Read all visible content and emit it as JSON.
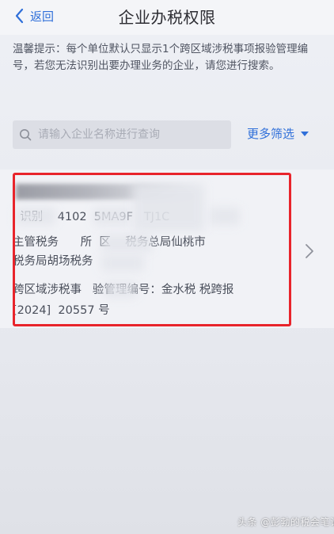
{
  "header": {
    "back_label": "返回",
    "title": "企业办税权限"
  },
  "notice": {
    "text": "温馨提示：每个单位默认只显示1个跨区域涉税事项报验管理编号，若您无法识别出要办理业务的企业，请您进行搜索。"
  },
  "search": {
    "placeholder": "请输入企业名称进行查询",
    "value": "",
    "more_filter_label": "更多筛选"
  },
  "card": {
    "title": "",
    "taxpayer_id_line": "  识别    4102  5MA9F   TJ1C",
    "authority_line_1": "主管税务      所  区    税务总局仙桃市",
    "authority_line_2": "税务局胡场税务",
    "report_line_1": "跨区域涉税事   验管理编号：金水税 税跨报",
    "report_line_2": "[2024]  20557 号"
  },
  "watermark": {
    "text": "头条 @彭勃的税会笔记"
  },
  "colors": {
    "accent": "#2f6fd9",
    "highlight_border": "#e8242b"
  }
}
